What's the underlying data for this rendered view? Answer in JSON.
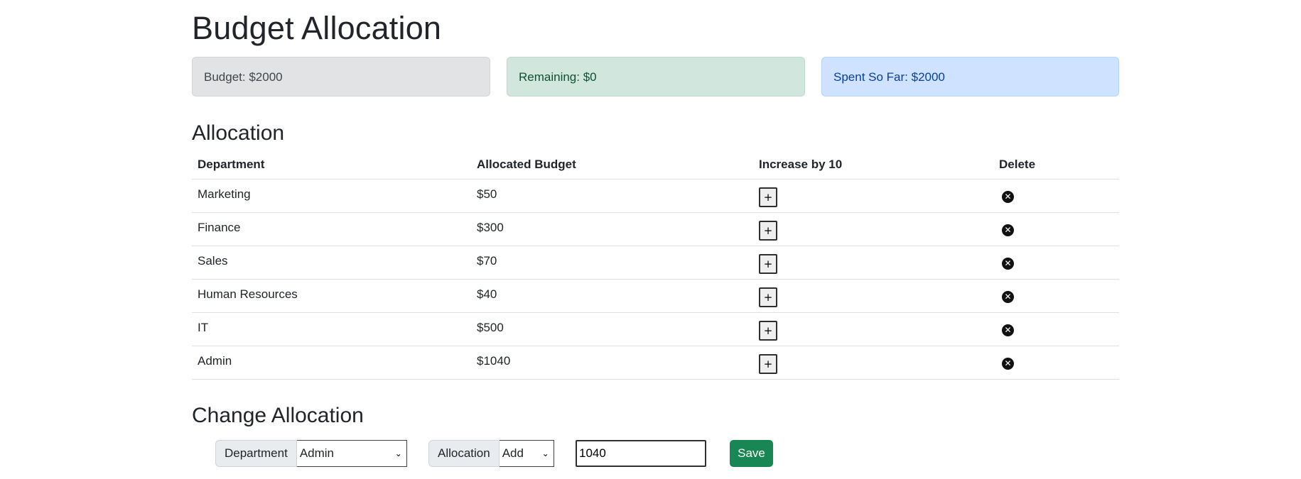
{
  "page": {
    "title": "Budget Allocation"
  },
  "summary": {
    "budget": "Budget: $2000",
    "remaining": "Remaining: $0",
    "spent": "Spent So Far: $2000"
  },
  "allocation": {
    "heading": "Allocation",
    "columns": [
      "Department",
      "Allocated Budget",
      "Increase by 10",
      "Delete"
    ],
    "rows": [
      {
        "department": "Marketing",
        "budget": "$50"
      },
      {
        "department": "Finance",
        "budget": "$300"
      },
      {
        "department": "Sales",
        "budget": "$70"
      },
      {
        "department": "Human Resources",
        "budget": "$40"
      },
      {
        "department": "IT",
        "budget": "$500"
      },
      {
        "department": "Admin",
        "budget": "$1040"
      }
    ],
    "increase_label": "+",
    "delete_icon": "x-circle-icon"
  },
  "change": {
    "heading": "Change Allocation",
    "department_label": "Department",
    "department_selected": "Admin",
    "allocation_label": "Allocation",
    "allocation_selected": "Add",
    "amount_value": "1040",
    "save_label": "Save"
  },
  "colors": {
    "budget_bg": "#e2e3e5",
    "remaining_bg": "#d1e7dd",
    "spent_bg": "#cfe2ff",
    "save_bg": "#198754"
  }
}
